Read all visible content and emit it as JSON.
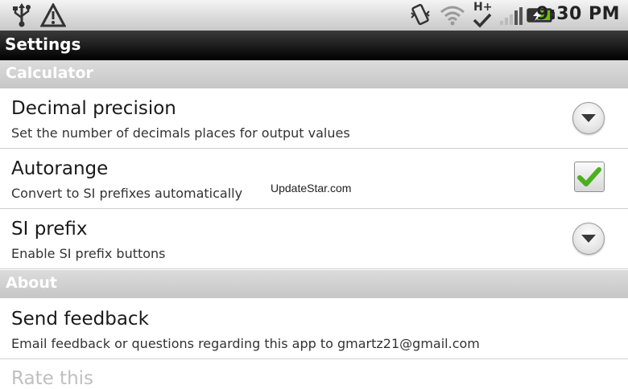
{
  "statusbar": {
    "icons_left": [
      "usb-icon",
      "warning-icon"
    ],
    "icons_right": [
      "vibrate-icon",
      "wifi-icon",
      "hspa-plus-icon",
      "signal-icon",
      "battery-charging-icon"
    ],
    "network_label": "H+",
    "time": "9:30 PM"
  },
  "titlebar": {
    "title": "Settings"
  },
  "sections": {
    "calculator": "Calculator",
    "about": "About"
  },
  "rows": {
    "decimal_precision": {
      "title": "Decimal precision",
      "summary": "Set the number of decimals places for output values",
      "control": "dropdown"
    },
    "autorange": {
      "title": "Autorange",
      "summary": "Convert to SI prefixes automatically",
      "control": "checkbox",
      "checked": true
    },
    "si_prefix": {
      "title": "SI prefix",
      "summary": "Enable SI prefix buttons",
      "control": "dropdown"
    },
    "send_feedback": {
      "title": "Send feedback",
      "summary": "Email feedback or questions regarding this app to gmartz21@gmail.com"
    },
    "partial": {
      "title": "Rate this"
    }
  },
  "watermark": "UpdateStar.com",
  "colors": {
    "checkmark": "#4caf1f",
    "section_bg": "#cfcfcf",
    "titlebar_bg": "#1b1b1b"
  }
}
